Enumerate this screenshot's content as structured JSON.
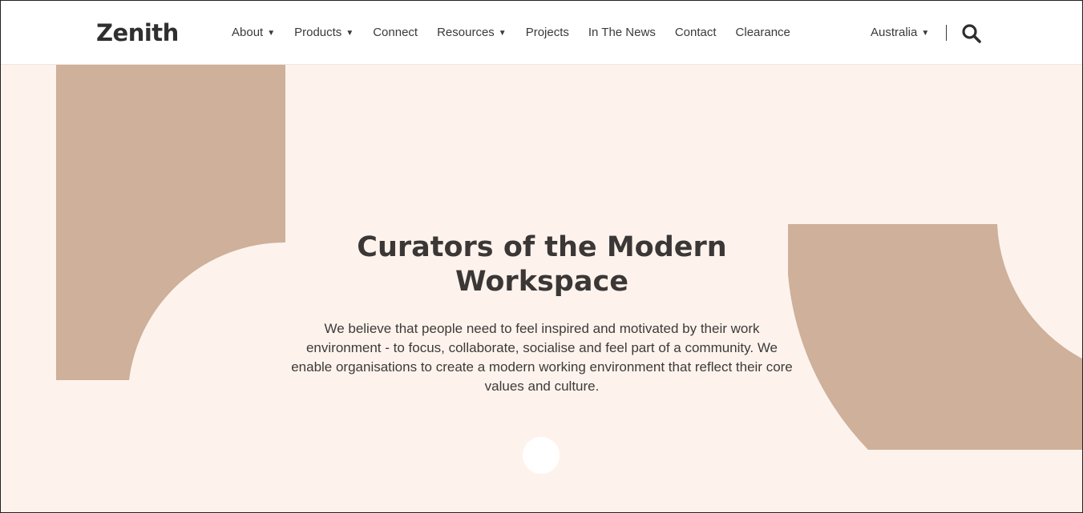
{
  "brand": {
    "logo_text": "Zenith"
  },
  "nav": {
    "items": [
      {
        "label": "About",
        "has_dropdown": true
      },
      {
        "label": "Products",
        "has_dropdown": true
      },
      {
        "label": "Connect",
        "has_dropdown": false
      },
      {
        "label": "Resources",
        "has_dropdown": true
      },
      {
        "label": "Projects",
        "has_dropdown": false
      },
      {
        "label": "In The News",
        "has_dropdown": false
      },
      {
        "label": "Contact",
        "has_dropdown": false
      },
      {
        "label": "Clearance",
        "has_dropdown": false
      }
    ],
    "caret_glyph": "▼"
  },
  "region": {
    "label": "Australia"
  },
  "icons": {
    "search": "search-icon",
    "caret": "caret-down-icon"
  },
  "hero": {
    "title": "Curators of the Modern Workspace",
    "description": "We believe that people need to feel inspired and motivated by their work environment - to focus, collaborate, socialise and feel part of a community. We enable organisations to create a modern working environment that reflect their core values and culture."
  },
  "colors": {
    "background": "#fdf3ec",
    "accent_shape": "#ceb09b",
    "text": "#3a3a3a",
    "header_bg": "#ffffff"
  }
}
